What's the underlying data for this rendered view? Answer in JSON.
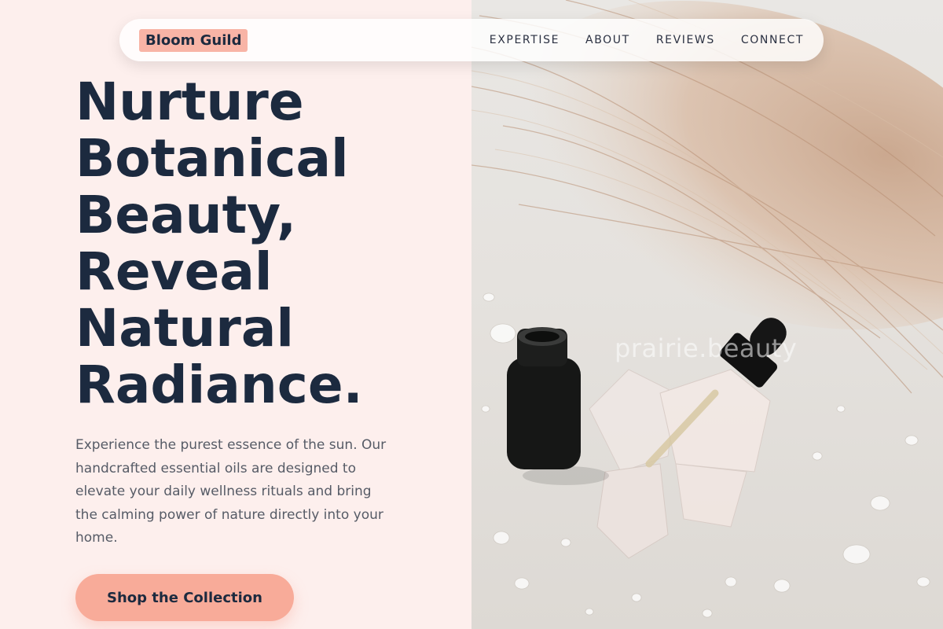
{
  "nav": {
    "brand": "Bloom Guild",
    "links": [
      "EXPERTISE",
      "ABOUT",
      "REVIEWS",
      "CONNECT"
    ]
  },
  "hero": {
    "headline_lines": [
      "Nurture",
      "Botanical",
      "Beauty,",
      "Reveal",
      "Natural",
      "Radiance."
    ],
    "subtext": "Experience the purest essence of the sun. Our handcrafted essential oils are designed to elevate your daily wellness rituals and bring the calming power of nature directly into your home.",
    "cta_label": "Shop the Collection"
  },
  "image": {
    "watermark": "prairie.beauty"
  },
  "colors": {
    "background": "#fdefed",
    "brand_badge": "#f8b4a6",
    "heading": "#1c2a3f",
    "cta": "#f8ab99"
  }
}
